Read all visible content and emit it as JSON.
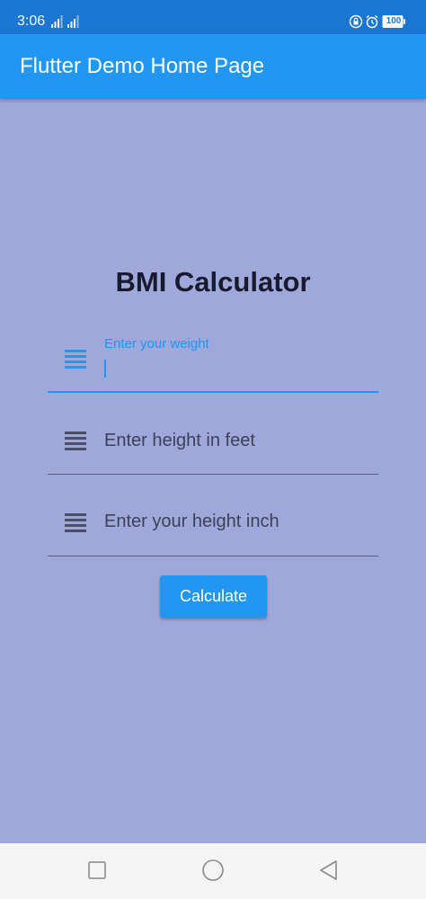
{
  "status_bar": {
    "time": "3:06",
    "battery": "100"
  },
  "app_bar": {
    "title": "Flutter Demo Home Page"
  },
  "main": {
    "heading": "BMI Calculator",
    "fields": [
      {
        "label": "Enter your weight",
        "value": "",
        "state": "focused"
      },
      {
        "placeholder": "Enter height in feet"
      },
      {
        "placeholder": "Enter your height inch"
      }
    ],
    "calculate_label": "Calculate"
  },
  "icons": {
    "field_icon": "list-icon",
    "nav": [
      "square-recents-icon",
      "circle-home-icon",
      "triangle-back-icon"
    ]
  },
  "colors": {
    "primary": "#2196f3",
    "status_bar": "#1976d2",
    "background": "#9fa8da"
  }
}
